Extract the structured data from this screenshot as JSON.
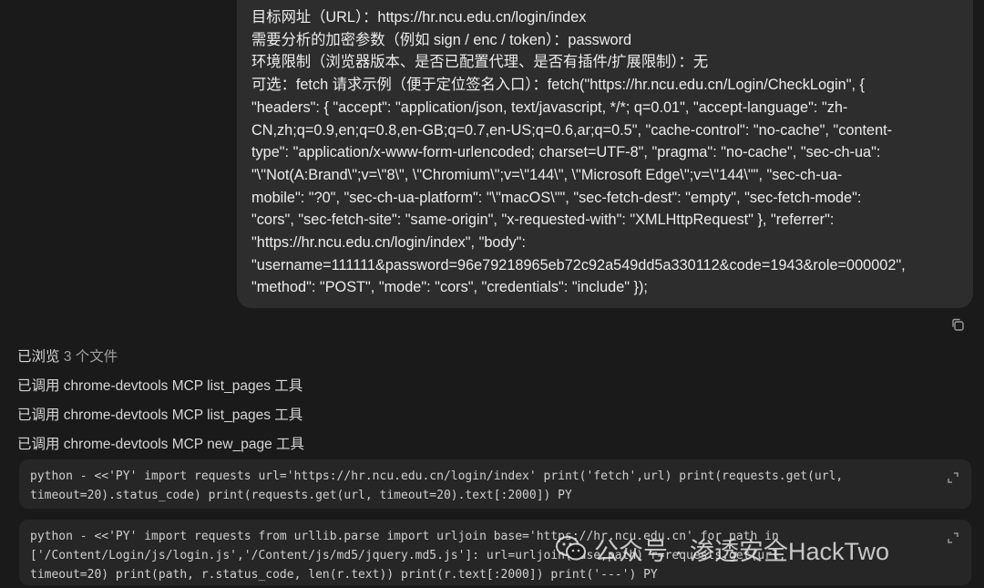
{
  "message": {
    "lines": [
      "目标网址（URL）：https://hr.ncu.edu.cn/login/index",
      "需要分析的加密参数（例如 sign / enc / token）：password",
      "环境限制（浏览器版本、是否已配置代理、是否有插件/扩展限制）：无",
      "可选：fetch 请求示例（便于定位签名入口）：fetch(\"https://hr.ncu.edu.cn/Login/CheckLogin\", {",
      "\"headers\": { \"accept\": \"application/json, text/javascript, */*; q=0.01\", \"accept-language\": \"zh-",
      "CN,zh;q=0.9,en;q=0.8,en-GB;q=0.7,en-US;q=0.6,ar;q=0.5\", \"cache-control\": \"no-cache\", \"content-",
      "type\": \"application/x-www-form-urlencoded; charset=UTF-8\", \"pragma\": \"no-cache\", \"sec-ch-ua\":",
      "\"\\\"Not(A:Brand\\\";v=\\\"8\\\", \\\"Chromium\\\";v=\\\"144\\\", \\\"Microsoft Edge\\\";v=\\\"144\\\"\", \"sec-ch-ua-",
      "mobile\": \"?0\", \"sec-ch-ua-platform\": \"\\\"macOS\\\"\", \"sec-fetch-dest\": \"empty\", \"sec-fetch-mode\":",
      "\"cors\", \"sec-fetch-site\": \"same-origin\", \"x-requested-with\": \"XMLHttpRequest\" }, \"referrer\":",
      "\"https://hr.ncu.edu.cn/login/index\", \"body\":",
      "\"username=111111&password=96e79218965eb72c92a549dd5a330112&code=1943&role=000002\",",
      "\"method\": \"POST\", \"mode\": \"cors\", \"credentials\": \"include\" });"
    ]
  },
  "copy_icon": "copy-icon",
  "steps": {
    "browsed_prefix": "已浏览",
    "browsed_count": "3 个文件",
    "items": [
      "已调用 chrome-devtools MCP list_pages 工具",
      "已调用 chrome-devtools MCP list_pages 工具",
      "已调用 chrome-devtools MCP new_page 工具"
    ]
  },
  "code_blocks": [
    {
      "lines": [
        "python - <<'PY' import requests url='https://hr.ncu.edu.cn/login/index' print('fetch',url) print(requests.get(url,",
        "timeout=20).status_code) print(requests.get(url, timeout=20).text[:2000]) PY"
      ]
    },
    {
      "lines": [
        "python - <<'PY' import requests from urllib.parse import urljoin base='https://hr.ncu.edu.cn' for path in",
        "['/Content/Login/js/login.js','/Content/js/md5/jquery.md5.js']: url=urljoin(base,path) r=requests.get(url,",
        "timeout=20) print(path, r.status_code, len(r.text)) print(r.text[:2000]) print('---') PY"
      ]
    }
  ],
  "watermark": {
    "text": "公众号 · 渗透安全HackTwo"
  },
  "colors": {
    "background": "#1a1a1a",
    "bubble": "#2d2d2d",
    "code_bg": "#262626",
    "text": "#ececec",
    "muted": "#a0a0a0"
  }
}
